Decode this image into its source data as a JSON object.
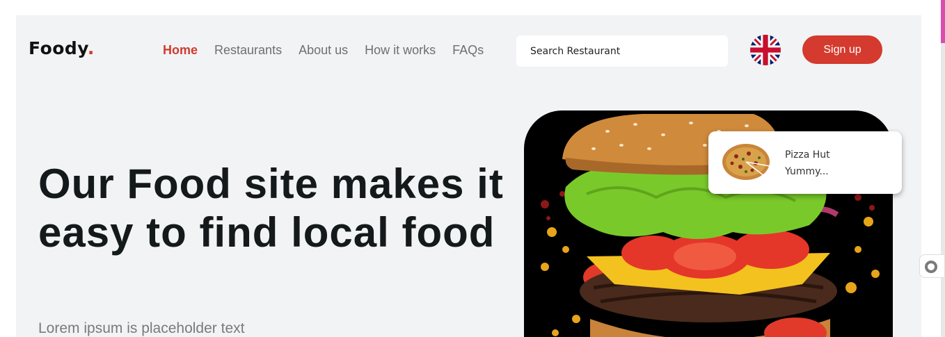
{
  "brand": {
    "name": "Foody",
    "dot": "."
  },
  "nav": {
    "items": [
      {
        "label": "Home",
        "active": true
      },
      {
        "label": "Restaurants",
        "active": false
      },
      {
        "label": "About us",
        "active": false
      },
      {
        "label": "How it works",
        "active": false
      },
      {
        "label": "FAQs",
        "active": false
      }
    ]
  },
  "search": {
    "placeholder": "Search Restaurant"
  },
  "language": {
    "icon": "uk-flag-icon"
  },
  "signup": {
    "label": "Sign up"
  },
  "hero": {
    "headline": "Our Food site makes it easy to find local food",
    "subtitle": "Lorem ipsum is placeholder text"
  },
  "card": {
    "title": "Pizza Hut",
    "subtitle": "Yummy..."
  },
  "colors": {
    "accent": "#d43a2d",
    "background": "#f2f3f5",
    "text": "#141a1c"
  }
}
